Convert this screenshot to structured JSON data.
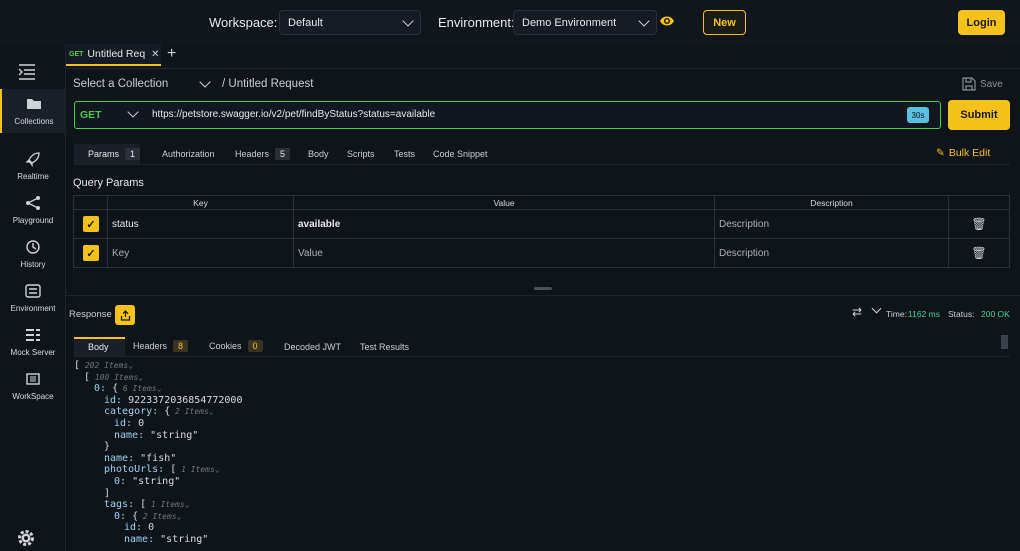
{
  "topbar": {
    "workspace_label": "Workspace:",
    "workspace_value": "Default",
    "environment_label": "Environment:",
    "environment_value": "Demo Environment",
    "new_label": "New",
    "login_label": "Login"
  },
  "sidebar": {
    "items": [
      {
        "label": "Collections",
        "icon": "folder-icon"
      },
      {
        "label": "Realtime",
        "icon": "rocket-icon"
      },
      {
        "label": "Playground",
        "icon": "share-icon"
      },
      {
        "label": "History",
        "icon": "history-icon"
      },
      {
        "label": "Environment",
        "icon": "environment-icon"
      },
      {
        "label": "Mock Server",
        "icon": "mock-server-icon"
      },
      {
        "label": "WorkSpace",
        "icon": "workspace-icon"
      }
    ]
  },
  "request_tab": {
    "method": "GET",
    "title": "Untitled Req"
  },
  "request": {
    "collection_placeholder": "Select a Collection",
    "title": "/ Untitled Request",
    "save_label": "Save",
    "method": "GET",
    "url": "https://petstore.swagger.io/v2/pet/findByStatus?status=available",
    "timeout": "30s",
    "submit_label": "Submit"
  },
  "req_tabs": {
    "params": "Params",
    "params_count": "1",
    "authorization": "Authorization",
    "headers": "Headers",
    "headers_count": "5",
    "body": "Body",
    "scripts": "Scripts",
    "tests": "Tests",
    "code_snippet": "Code Snippet",
    "bulk_edit": "Bulk Edit"
  },
  "query": {
    "title": "Query Params",
    "headers": {
      "key": "Key",
      "value": "Value",
      "description": "Description"
    },
    "rows": [
      {
        "key": "status",
        "value": "available",
        "description": "Description"
      },
      {
        "key": "Key",
        "value": "Value",
        "description": "Description"
      }
    ]
  },
  "response": {
    "label": "Response",
    "time_label": "Time:",
    "time_value": "1162 ms",
    "status_label": "Status:",
    "status_value": "200 OK",
    "tabs": {
      "body": "Body",
      "headers": "Headers",
      "headers_count": "8",
      "cookies": "Cookies",
      "cookies_count": "0",
      "decoded_jwt": "Decoded JWT",
      "test_results": "Test Results"
    }
  },
  "json_lines": [
    {
      "text": "[",
      "note": "202 Items"
    },
    {
      "text": "[",
      "note": "100 Items"
    },
    {
      "text": "0: {",
      "note": "6 Items"
    },
    {
      "text": "id: 9223372036854772000"
    },
    {
      "text": "category: {",
      "note": "2 Items"
    },
    {
      "text": "id: 0"
    },
    {
      "text": "name: \"string\""
    },
    {
      "text": "}"
    },
    {
      "text": "name: \"fish\""
    },
    {
      "text": "photoUrls: [",
      "note": "1 Items"
    },
    {
      "text": "0: \"string\""
    },
    {
      "text": "]"
    },
    {
      "text": "tags: [",
      "note": "1 Items"
    },
    {
      "text": "0: {",
      "note": "2 Items"
    },
    {
      "text": "id: 0"
    },
    {
      "text": "name: \"string\""
    }
  ],
  "colors": {
    "accent": "#f5c21b",
    "get_method": "#4ec94e",
    "status_ok": "#3ecf8e",
    "timeout_chip": "#5bc0de"
  }
}
